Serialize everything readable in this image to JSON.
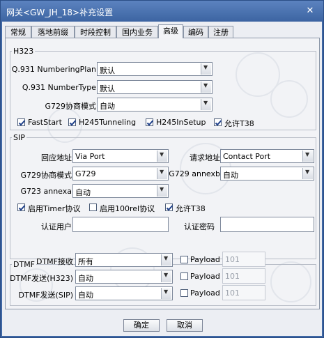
{
  "window": {
    "title": "网关<GW_JH_18>补充设置",
    "close_glyph": "✕"
  },
  "tabs": [
    {
      "label": "常规"
    },
    {
      "label": "落地前缀"
    },
    {
      "label": "时段控制"
    },
    {
      "label": "国内业务"
    },
    {
      "label": "高级",
      "active": true
    },
    {
      "label": "编码"
    },
    {
      "label": "注册"
    }
  ],
  "h323": {
    "legend": "H323",
    "numbering_plan": {
      "label": "Q.931 NumberingPlan",
      "value": "默认"
    },
    "number_type": {
      "label": "Q.931 NumberType",
      "value": "默认"
    },
    "g729_mode": {
      "label": "G729协商模式",
      "value": "自动"
    },
    "checks": [
      {
        "label": "FastStart",
        "checked": true
      },
      {
        "label": "H245Tunneling",
        "checked": true
      },
      {
        "label": "H245InSetup",
        "checked": true
      },
      {
        "label": "允许T38",
        "checked": true
      }
    ]
  },
  "sip": {
    "legend": "SIP",
    "reply_addr": {
      "label": "回应地址",
      "value": "Via Port"
    },
    "request_addr": {
      "label": "请求地址",
      "value": "Contact Port"
    },
    "g729_mode": {
      "label": "G729协商模式",
      "value": "G729"
    },
    "g729_annexb": {
      "label": "G729 annexb",
      "value": "自动"
    },
    "g723_annexa": {
      "label": "G723 annexa",
      "value": "自动"
    },
    "checks": [
      {
        "label": "启用Timer协议",
        "checked": true
      },
      {
        "label": "启用100rel协议",
        "checked": false
      },
      {
        "label": "允许T38",
        "checked": true
      }
    ],
    "auth_user": {
      "label": "认证用户",
      "value": ""
    },
    "auth_pass": {
      "label": "认证密码",
      "value": ""
    }
  },
  "dtmf": {
    "legend": "DTMF",
    "rows": [
      {
        "label": "DTMF接收",
        "value": "所有",
        "payload_label": "Payload",
        "payload_checked": false,
        "payload_value": "101"
      },
      {
        "label": "DTMF发送(H323)",
        "value": "自动",
        "payload_label": "Payload",
        "payload_checked": false,
        "payload_value": "101"
      },
      {
        "label": "DTMF发送(SIP)",
        "value": "自动",
        "payload_label": "Payload",
        "payload_checked": false,
        "payload_value": "101"
      }
    ]
  },
  "buttons": {
    "ok": "确定",
    "cancel": "取消"
  },
  "colors": {
    "titlebar": "#4a72b0",
    "panel": "#f2f3f6",
    "border": "#8c97a8"
  }
}
